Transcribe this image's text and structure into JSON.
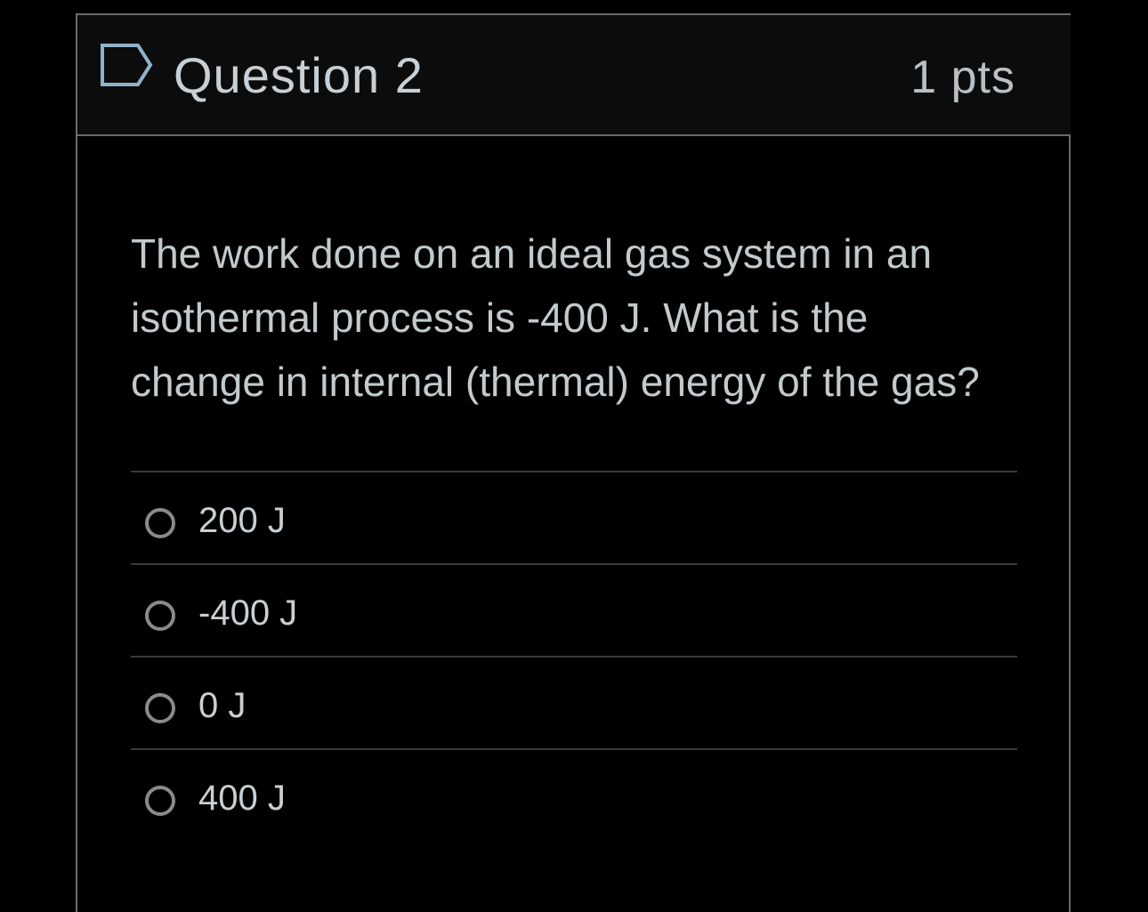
{
  "question": {
    "title": "Question 2",
    "points": "1 pts",
    "flag_icon": "flag-outline-icon",
    "text": "The work done on an ideal gas system in an isothermal process is -400 J. What is the change in internal (thermal) energy of the gas?",
    "answers": [
      {
        "label": "200 J",
        "selected": false
      },
      {
        "label": "-400 J",
        "selected": false
      },
      {
        "label": "0 J",
        "selected": false
      },
      {
        "label": "400 J",
        "selected": false
      }
    ]
  },
  "colors": {
    "background": "#000000",
    "header_background": "#0c0c0c",
    "border": "#6b6b6b",
    "flag_stroke": "#8fb3c9",
    "text": "#c3cace"
  }
}
